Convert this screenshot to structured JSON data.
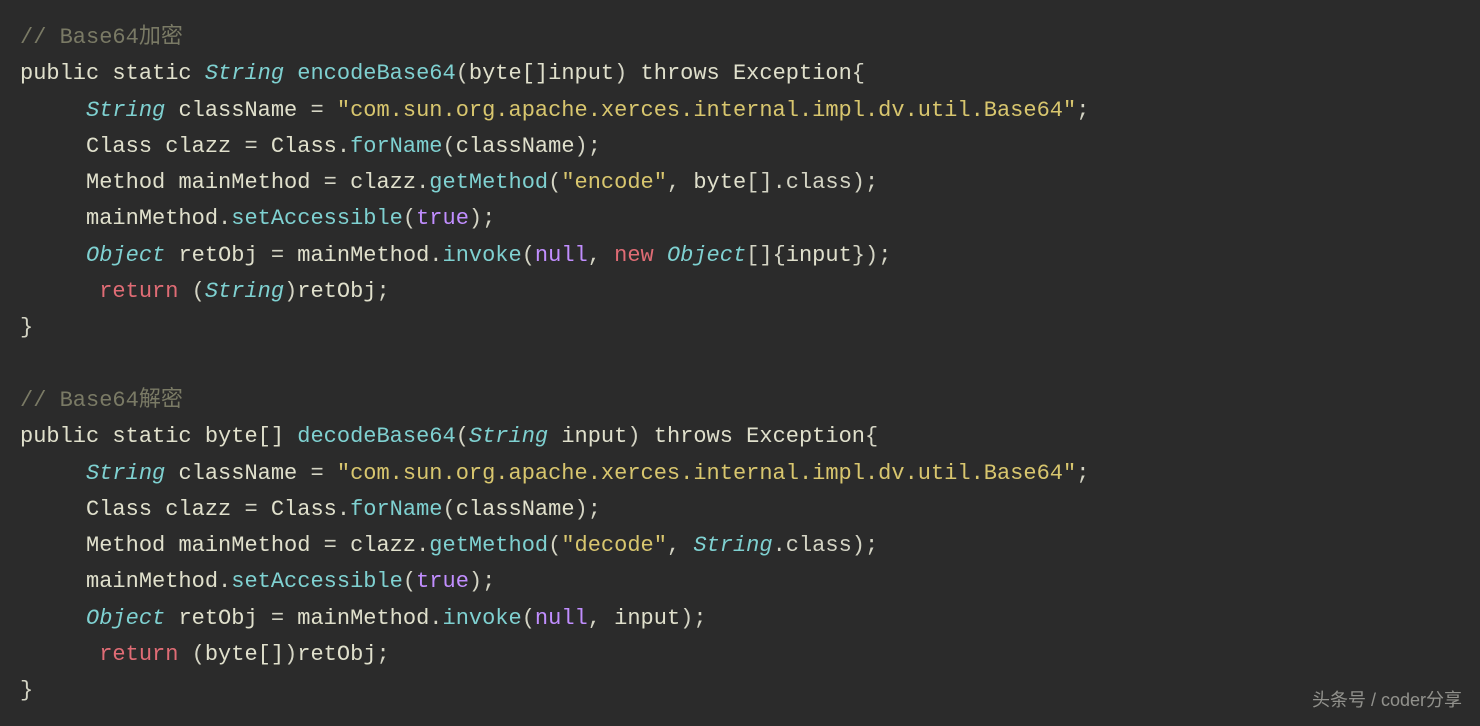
{
  "code": {
    "comment1_a": "// Base64",
    "comment1_b": "加密",
    "kw_public": "public",
    "kw_static": "static",
    "kw_throws": "throws",
    "kw_return": "return",
    "kw_new": "new",
    "kw_true": "true",
    "kw_null": "null",
    "type_String": "String",
    "type_Object": "Object",
    "type_Class": "Class",
    "type_Method": "Method",
    "type_Exception": "Exception",
    "type_byte_arr": "byte[]",
    "type_byte": "byte",
    "m_encodeBase64": "encodeBase64",
    "m_decodeBase64": "decodeBase64",
    "m_forName": "forName",
    "m_getMethod": "getMethod",
    "m_setAccessible": "setAccessible",
    "m_invoke": "invoke",
    "v_input": "input",
    "v_className": "className",
    "v_clazz": "clazz",
    "v_mainMethod": "mainMethod",
    "v_retObj": "retObj",
    "s_classname": "\"com.sun.org.apache.xerces.internal.impl.dv.util.Base64\"",
    "s_encode": "\"encode\"",
    "s_decode": "\"decode\"",
    "p_class": ".class",
    "comment2_a": "// Base64",
    "comment2_b": "解密",
    "arr": "[]"
  },
  "watermark": "头条号 / coder分享"
}
